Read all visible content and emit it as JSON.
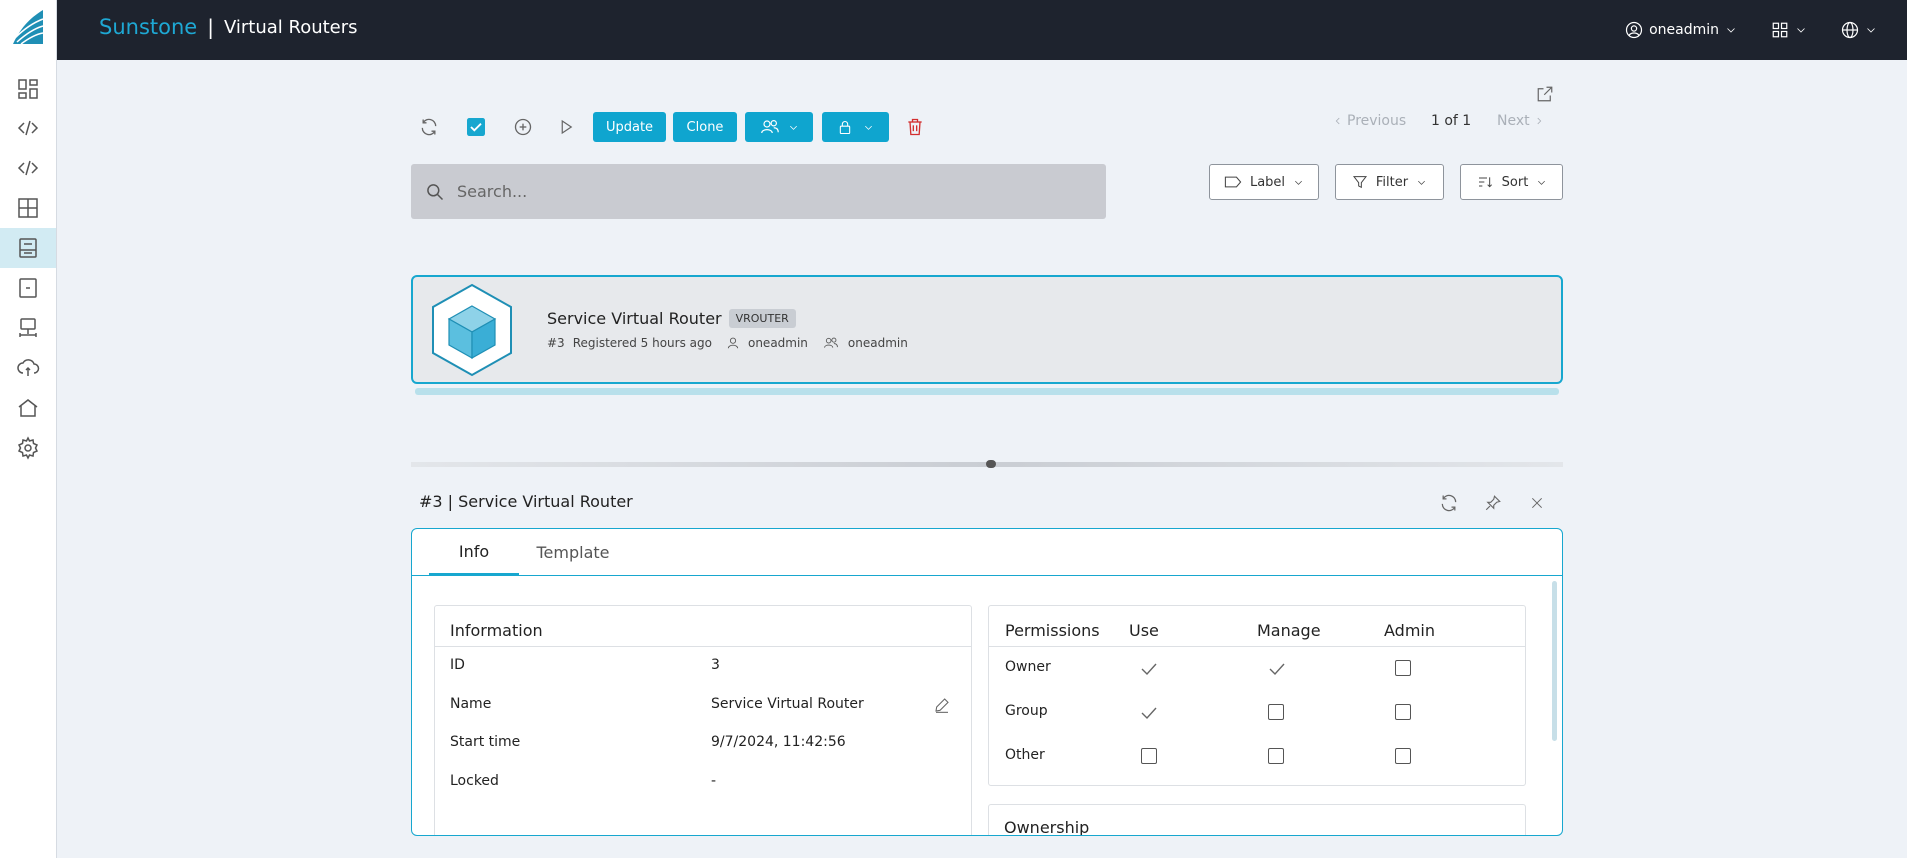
{
  "header": {
    "brand": "Sunstone",
    "separator": "|",
    "page_title": "Virtual Routers",
    "user": "oneadmin"
  },
  "sidebar": {
    "items": [
      {
        "icon": "dashboard-icon"
      },
      {
        "icon": "code-icon"
      },
      {
        "icon": "code-icon"
      },
      {
        "icon": "templates-icon"
      },
      {
        "icon": "storage-icon",
        "active": true
      },
      {
        "icon": "archive-icon"
      },
      {
        "icon": "network-icon"
      },
      {
        "icon": "cloud-sync-icon"
      },
      {
        "icon": "home-icon"
      },
      {
        "icon": "settings-icon"
      }
    ]
  },
  "toolbar": {
    "update_label": "Update",
    "clone_label": "Clone"
  },
  "pagination": {
    "previous": "Previous",
    "page_info": "1 of 1",
    "next": "Next"
  },
  "search": {
    "placeholder": "Search..."
  },
  "filters": {
    "label": "Label",
    "filter": "Filter",
    "sort": "Sort"
  },
  "list": {
    "items": [
      {
        "name": "Service Virtual Router",
        "badge": "VROUTER",
        "id": "#3",
        "registered": "Registered 5 hours ago",
        "owner": "oneadmin",
        "group": "oneadmin"
      }
    ]
  },
  "detail": {
    "title": "#3 | Service Virtual Router",
    "tabs": [
      "Info",
      "Template"
    ],
    "information": {
      "heading": "Information",
      "rows": [
        {
          "label": "ID",
          "value": "3"
        },
        {
          "label": "Name",
          "value": "Service Virtual Router"
        },
        {
          "label": "Start time",
          "value": "9/7/2024, 11:42:56"
        },
        {
          "label": "Locked",
          "value": "-"
        }
      ]
    },
    "permissions": {
      "heading": "Permissions",
      "columns": [
        "Use",
        "Manage",
        "Admin"
      ],
      "rows": [
        {
          "label": "Owner",
          "values": [
            true,
            true,
            false
          ]
        },
        {
          "label": "Group",
          "values": [
            true,
            false,
            false
          ]
        },
        {
          "label": "Other",
          "values": [
            false,
            false,
            false
          ]
        }
      ]
    },
    "ownership": {
      "heading": "Ownership"
    }
  },
  "colors": {
    "accent": "#17a7cf",
    "topbar": "#1e232e",
    "danger": "#d32f2f"
  }
}
